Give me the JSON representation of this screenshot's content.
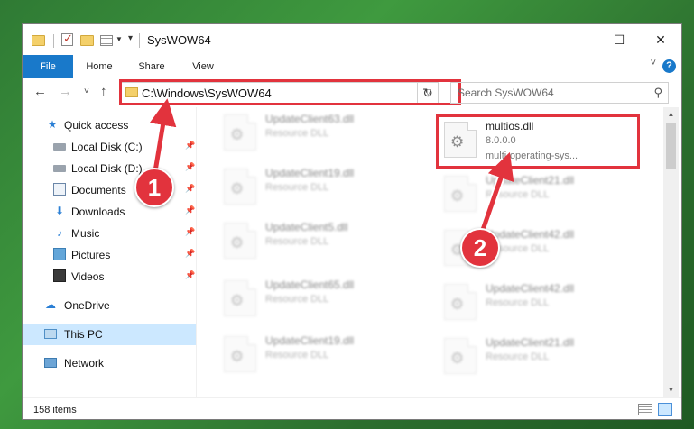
{
  "window": {
    "title": "SysWOW64",
    "minimize_glyph": "—",
    "maximize_glyph": "☐",
    "close_glyph": "✕"
  },
  "ribbon": {
    "tabs": [
      "File",
      "Home",
      "Share",
      "View"
    ],
    "help_label": "?",
    "toggle_glyph": "˅"
  },
  "nav": {
    "back": "←",
    "forward": "→",
    "recent": "˅",
    "up": "↑",
    "address": "C:\\Windows\\SysWOW64",
    "refresh": "↻",
    "search_placeholder": "Search SysWOW64",
    "search_glyph": "⚲"
  },
  "sidebar": {
    "items": [
      {
        "label": "Quick access",
        "icon": "star-icon",
        "pinned": false
      },
      {
        "label": "Local Disk (C:)",
        "icon": "disk-icon",
        "pinned": true
      },
      {
        "label": "Local Disk (D:)",
        "icon": "disk-icon",
        "pinned": true
      },
      {
        "label": "Documents",
        "icon": "documents-icon",
        "pinned": true
      },
      {
        "label": "Downloads",
        "icon": "download-icon",
        "pinned": true
      },
      {
        "label": "Music",
        "icon": "music-icon",
        "pinned": true
      },
      {
        "label": "Pictures",
        "icon": "pictures-icon",
        "pinned": true
      },
      {
        "label": "Videos",
        "icon": "video-icon",
        "pinned": true
      },
      {
        "label": "OneDrive",
        "icon": "cloud-icon",
        "pinned": false
      },
      {
        "label": "This PC",
        "icon": "pc-icon",
        "pinned": false
      },
      {
        "label": "Network",
        "icon": "network-icon",
        "pinned": false
      }
    ],
    "pin_glyph": "📌"
  },
  "files": [
    {
      "name": "UpdateClient63.dll",
      "type": "Resource DLL"
    },
    {
      "name": "multios.dll",
      "type": "8.0.0.0",
      "extra": "multi-operating-sys..."
    },
    {
      "name": "UpdateClient19.dll",
      "type": "Resource DLL"
    },
    {
      "name": "UpdateClient21.dll",
      "type": "Resource DLL"
    },
    {
      "name": "UpdateClient5.dll",
      "type": "Resource DLL"
    },
    {
      "name": "UpdateClient42.dll",
      "type": "Resource DLL"
    },
    {
      "name": "UpdateClient65.dll",
      "type": "Resource DLL"
    },
    {
      "name": "UpdateClient42.dll",
      "type": "Resource DLL"
    },
    {
      "name": "UpdateClient19.dll",
      "type": "Resource DLL"
    },
    {
      "name": "UpdateClient21.dll",
      "type": "Resource DLL"
    }
  ],
  "status": {
    "item_count": "158 items"
  },
  "annotations": {
    "step1": "1",
    "step2": "2",
    "highlight_color": "#e2333d"
  },
  "colors": {
    "accent": "#1979ca",
    "selection": "#cce8ff"
  }
}
